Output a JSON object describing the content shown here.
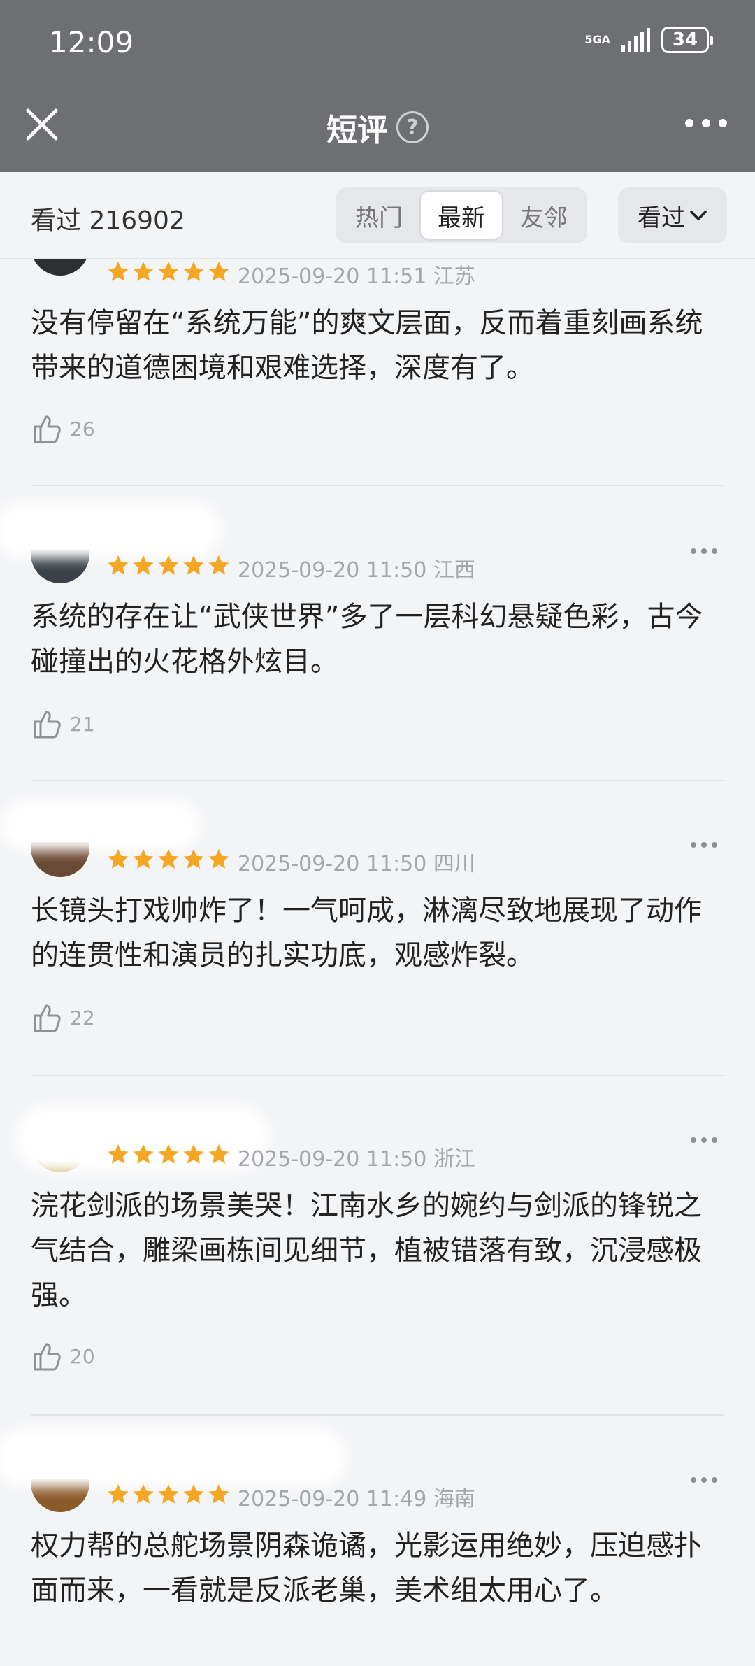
{
  "status": {
    "time": "12:09",
    "network": "5GA",
    "battery": "34"
  },
  "header": {
    "title": "短评"
  },
  "filter": {
    "seen_label": "看过 216902",
    "tabs": [
      "热门",
      "最新",
      "友邻"
    ],
    "active_tab": "最新",
    "dropdown_label": "看过"
  },
  "colors": {
    "star": "#f5a623",
    "header_bg": "#6e6f73"
  },
  "reviews": [
    {
      "rating": 5,
      "time": "2025-09-20 11:51 江苏",
      "content": "没有停留在“系统万能”的爽文层面，反而着重刻画系统带来的道德困境和艰难选择，深度有了。",
      "likes": "26"
    },
    {
      "rating": 5,
      "time": "2025-09-20 11:50 江西",
      "content": "系统的存在让“武侠世界”多了一层科幻悬疑色彩，古今碰撞出的火花格外炫目。",
      "likes": "21"
    },
    {
      "rating": 5,
      "time": "2025-09-20 11:50 四川",
      "content": "长镜头打戏帅炸了！一气呵成，淋漓尽致地展现了动作的连贯性和演员的扎实功底，观感炸裂。",
      "likes": "22"
    },
    {
      "rating": 5,
      "time": "2025-09-20 11:50 浙江",
      "content": "浣花剑派的场景美哭！江南水乡的婉约与剑派的锋锐之气结合，雕梁画栋间见细节，植被错落有致，沉浸感极强。",
      "likes": "20"
    },
    {
      "rating": 5,
      "time": "2025-09-20 11:49 海南",
      "content": "权力帮的总舵场景阴森诡谲，光影运用绝妙，压迫感扑面而来，一看就是反派老巢，美术组太用心了。",
      "likes": ""
    }
  ]
}
